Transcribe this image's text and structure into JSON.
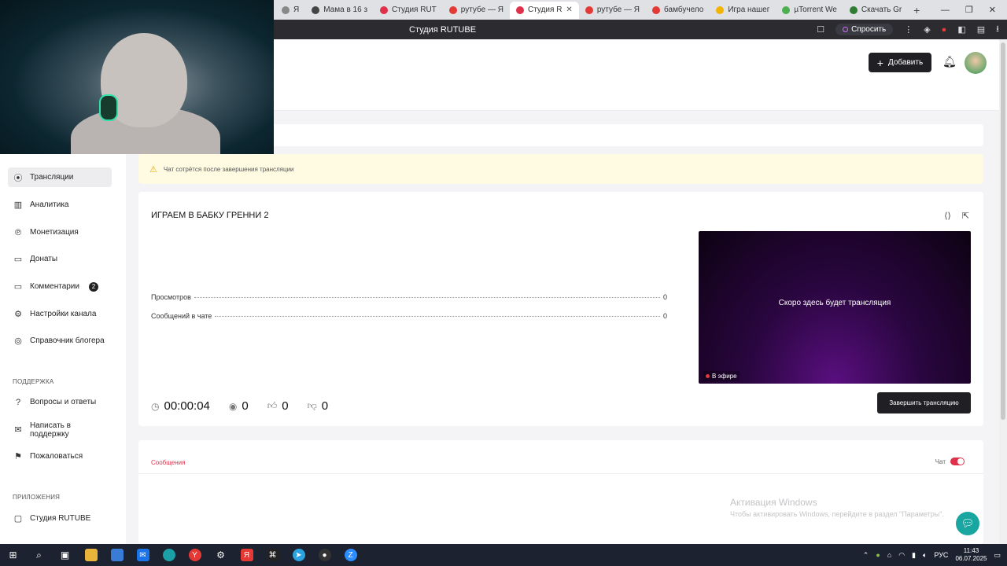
{
  "browser": {
    "tabs": [
      {
        "label": "Я",
        "color": "#888"
      },
      {
        "label": "Мама в 16 з",
        "color": "#444"
      },
      {
        "label": "Студия RUT",
        "color": "#e0304a"
      },
      {
        "label": "рутубе — Я",
        "color": "#e53935"
      },
      {
        "label": "Студия R",
        "color": "#e0304a",
        "active": true
      },
      {
        "label": "рутубе — Я",
        "color": "#e53935"
      },
      {
        "label": "бамбучело",
        "color": "#e53935"
      },
      {
        "label": "Игра нашег",
        "color": "#f2b400"
      },
      {
        "label": "µTorrent We",
        "color": "#4caf50"
      },
      {
        "label": "Скачать Gr",
        "color": "#2e7d32"
      }
    ],
    "active_tab_close": "✕",
    "new_tab": "+",
    "page_title": "Студия RUTUBE",
    "ask_label": "Спросить",
    "window_controls": [
      "—",
      "❐",
      "✕"
    ]
  },
  "header": {
    "add_button": "Добавить",
    "add_icon": "+",
    "bell_icon": "🔔"
  },
  "sidebar": {
    "items": [
      {
        "label": "Трансляции",
        "icon": "((•))",
        "active": true
      },
      {
        "label": "Аналитика",
        "icon": "▥"
      },
      {
        "label": "Монетизация",
        "icon": "℗"
      },
      {
        "label": "Донаты",
        "icon": "▭"
      },
      {
        "label": "Комментарии",
        "icon": "▭",
        "badge": "2"
      },
      {
        "label": "Настройки канала",
        "icon": "⚙"
      },
      {
        "label": "Справочник блогера",
        "icon": "◎"
      }
    ],
    "support_heading": "ПОДДЕРЖКА",
    "support_items": [
      {
        "label": "Вопросы и ответы",
        "icon": "?"
      },
      {
        "label": "Написать в поддержку",
        "icon": "✉"
      },
      {
        "label": "Пожаловаться",
        "icon": "⚑"
      }
    ],
    "apps_heading": "ПРИЛОЖЕНИЯ",
    "apps_items": [
      {
        "label": "Студия RUTUBE",
        "icon": "▢"
      }
    ]
  },
  "warning": {
    "text": "Чат сотрётся после завершения трансляции"
  },
  "stream": {
    "title": "ИГРАЕМ В БАБКУ ГРЕННИ 2",
    "stats": [
      {
        "label": "Просмотров",
        "value": "0"
      },
      {
        "label": "Сообщений в чате",
        "value": "0"
      }
    ],
    "duration": "00:00:04",
    "viewers": "0",
    "likes": "0",
    "dislikes": "0",
    "preview_text": "Скоро здесь будет трансляция",
    "live_label": "В эфире",
    "end_button": "Завершить трансляцию"
  },
  "chat": {
    "tab_messages": "Сообщения",
    "chat_toggle_label": "Чат",
    "chat_enabled": true
  },
  "watermark": {
    "line1": "Активация Windows",
    "line2": "Чтобы активировать Windows, перейдите в раздел \"Параметры\"."
  },
  "taskbar": {
    "time": "11:43",
    "date": "06.07.2025",
    "lang": "РУС"
  }
}
